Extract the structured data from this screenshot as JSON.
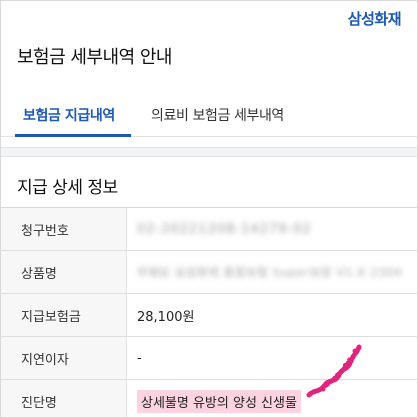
{
  "header": {
    "brand": "삼성화재",
    "page_title": "보험금 세부내역 안내"
  },
  "tabs": [
    {
      "label": "보험금 지급내역",
      "active": true
    },
    {
      "label": "의료비 보험금 세부내역",
      "active": false
    }
  ],
  "section": {
    "title": "지급 상세 정보"
  },
  "rows": [
    {
      "label": "청구번호",
      "value": "02-20221208-14279-02",
      "obscured": true
    },
    {
      "label": "상품명",
      "value": "무배당 삼성화재 통합보험 Super보장 V1.0 2304",
      "obscured": true
    },
    {
      "label": "지급보험금",
      "value": "28,100원",
      "obscured": false
    },
    {
      "label": "지연이자",
      "value": "-",
      "obscured": false
    },
    {
      "label": "진단명",
      "value": "상세불명 유방의 양성 신생물",
      "obscured": false,
      "highlighted": true
    }
  ],
  "colors": {
    "brand_blue": "#1c58b6",
    "highlight_pink": "#fbd3e1",
    "scribble_magenta": "#e0257e"
  }
}
